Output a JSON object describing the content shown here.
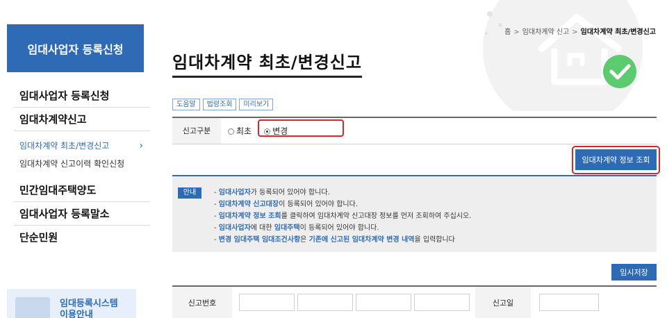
{
  "sidebar": {
    "header": "임대사업자 등록신청",
    "menu": [
      "임대사업자 등록신청",
      "임대차계약신고",
      "임대차계약 최초/변경신고",
      "임대차계약 신고이력 확인신청",
      "민간임대주택양도",
      "임대사업자 등록말소",
      "단순민원"
    ],
    "banner_line1": "임대등록시스템",
    "banner_line2": "이용안내"
  },
  "breadcrumb": {
    "home": "홈",
    "level1": "임대차계약 신고",
    "current": "임대차계약 최초/변경신고"
  },
  "page_title": "임대차계약 최초/변경신고",
  "tools": [
    "도움말",
    "법령조회",
    "미리보기"
  ],
  "form": {
    "label": "신고구분",
    "option_first": "최초",
    "option_change": "변경",
    "selected": "변경"
  },
  "buttons": {
    "lookup": "임대차계약 정보 조회",
    "save": "임시저장"
  },
  "notice": {
    "tag": "안내",
    "lines": [
      [
        "- ",
        "임대사업자",
        "가 등록되어 있어야 합니다."
      ],
      [
        "- ",
        "임대차계약 신고대장",
        "이 등록되어 있어야 합니다."
      ],
      [
        "- ",
        "임대차계약 정보 조회",
        "를 클릭하여 임대차계약 신고대장 정보를 먼저 조회하여 주십시오."
      ],
      [
        "- ",
        "임대사업자",
        "에 대한 ",
        "임대주택",
        "이 등록되어 있어야 합니다."
      ],
      [
        "- ",
        "변경 임대주택 임대조건사항",
        "은 ",
        "기존에 신고된 임대차계약 변경 내역",
        "을 입력합니다"
      ]
    ]
  },
  "table": {
    "label_no": "신고번호",
    "label_date": "신고일"
  },
  "colors": {
    "primary": "#2e6bb4",
    "highlight": "#d8262b",
    "check_green": "#5ccb6f"
  }
}
